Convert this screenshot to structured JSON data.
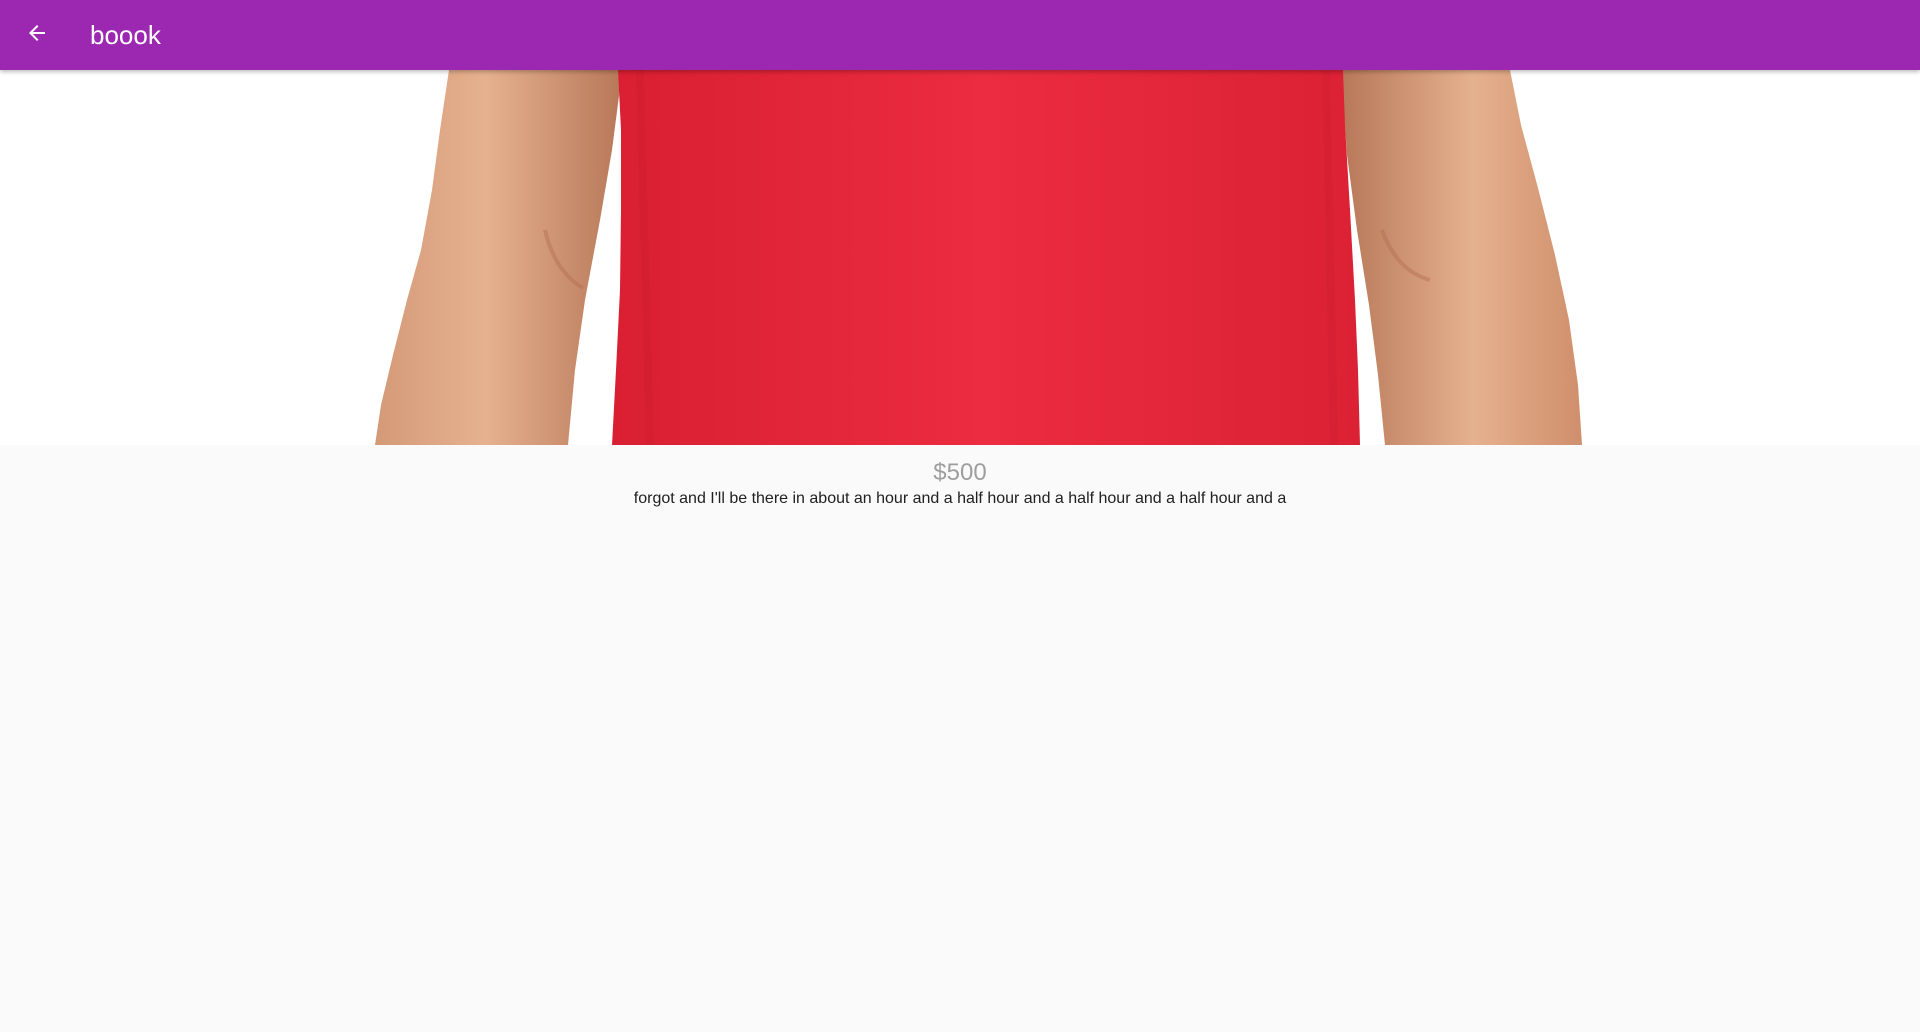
{
  "app_bar": {
    "title": "boook",
    "back_icon": "arrow-back-icon",
    "background_color": "#9c27b0"
  },
  "product": {
    "image": "red-t-shirt-image",
    "price": "$500",
    "description": "forgot and I'll be there in about an hour and a half hour and a half hour and a half hour and a"
  },
  "colors": {
    "page_background": "#fafafa",
    "price_text": "#9e9e9e",
    "description_text": "#212121",
    "shirt_red": "#e8283a"
  }
}
